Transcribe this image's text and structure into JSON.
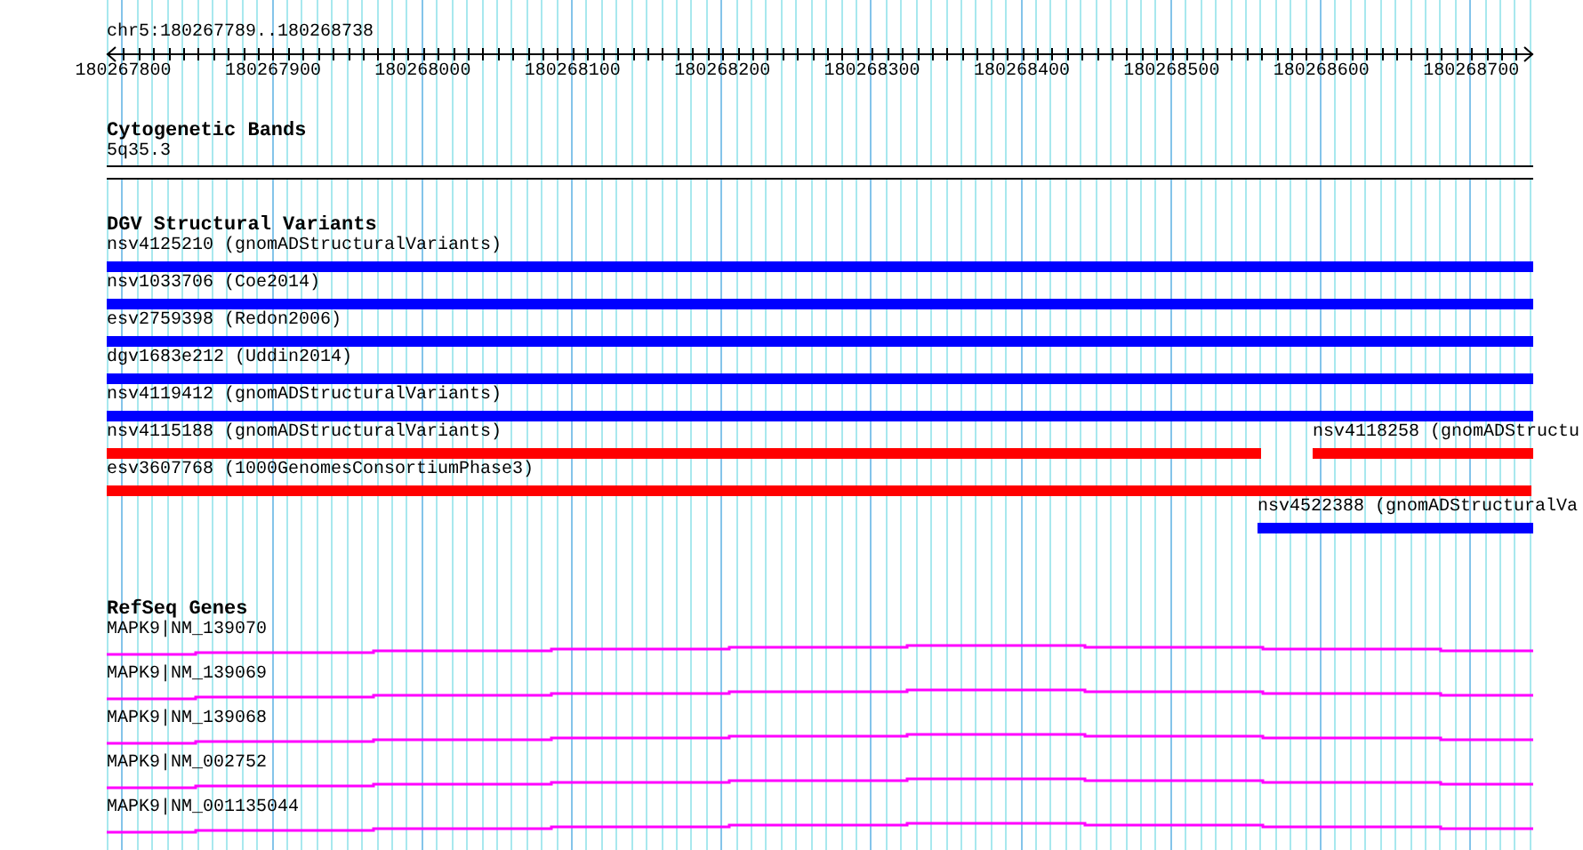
{
  "ruler": {
    "region": "chr5:180267789..180268738",
    "tick_labels": [
      "180267800",
      "180267900",
      "180268000",
      "180268100",
      "180268200",
      "180268300",
      "180268400",
      "180268500",
      "180268600",
      "180268700"
    ]
  },
  "cytogenetic_bands": {
    "title": "Cytogenetic Bands",
    "band": "5q35.3"
  },
  "dgv": {
    "title": "DGV Structural Variants",
    "variants": [
      {
        "label": "nsv4125210 (gnomADStructuralVariants)",
        "color": "#0000ff"
      },
      {
        "label": "nsv1033706 (Coe2014)",
        "color": "#0000ff"
      },
      {
        "label": "esv2759398 (Redon2006)",
        "color": "#0000ff"
      },
      {
        "label": "dgv1683e212 (Uddin2014)",
        "color": "#0000ff"
      },
      {
        "label": "nsv4119412 (gnomADStructuralVariants)",
        "color": "#0000ff"
      },
      {
        "label": "nsv4115188 (gnomADStructuralVariants)",
        "color": "#ff0000"
      },
      {
        "label": "nsv4118258 (gnomADStructu",
        "color": "#ff0000"
      },
      {
        "label": "esv3607768 (1000GenomesConsortiumPhase3)",
        "color": "#ff0000"
      },
      {
        "label": "nsv4522388 (gnomADStructuralVa",
        "color": "#0000ff"
      }
    ]
  },
  "refseq": {
    "title": "RefSeq Genes",
    "genes": [
      {
        "label": "MAPK9|NM_139070"
      },
      {
        "label": "MAPK9|NM_139069"
      },
      {
        "label": "MAPK9|NM_139068"
      },
      {
        "label": "MAPK9|NM_002752"
      },
      {
        "label": "MAPK9|NM_001135044"
      }
    ]
  }
}
